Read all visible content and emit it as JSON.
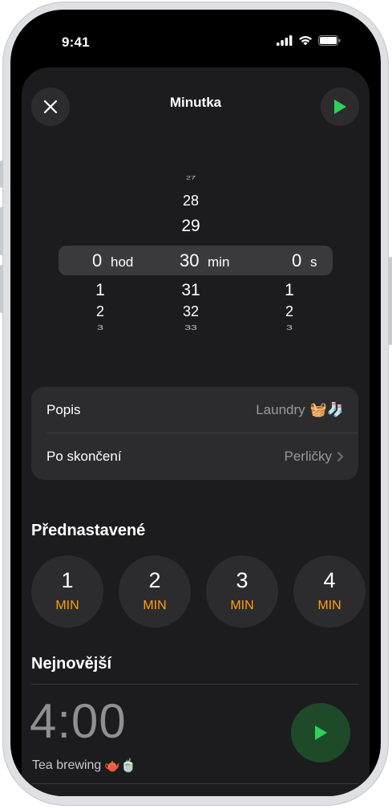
{
  "status_bar": {
    "time": "9:41"
  },
  "header": {
    "title": "Minutka"
  },
  "picker": {
    "hours": {
      "above": [],
      "selected": "0",
      "unit": "hod",
      "below": [
        "1",
        "2",
        "3"
      ]
    },
    "minutes": {
      "above": [
        "27",
        "28",
        "29"
      ],
      "selected": "30",
      "unit": "min",
      "below": [
        "31",
        "32",
        "33"
      ]
    },
    "seconds": {
      "above": [],
      "selected": "0",
      "unit": "s",
      "below": [
        "1",
        "2",
        "3"
      ]
    }
  },
  "settings": {
    "description_label": "Popis",
    "description_value": "Laundry",
    "description_emoji": "🧺🧦",
    "when_done_label": "Po skončení",
    "when_done_value": "Perličky"
  },
  "presets": {
    "title": "Přednastavené",
    "items": [
      {
        "value": "1",
        "unit": "MIN"
      },
      {
        "value": "2",
        "unit": "MIN"
      },
      {
        "value": "3",
        "unit": "MIN"
      },
      {
        "value": "4",
        "unit": "MIN"
      }
    ]
  },
  "recent": {
    "title": "Nejnovější",
    "time": "4:00",
    "label": "Tea brewing",
    "emoji": "🫖🍵"
  },
  "colors": {
    "accent_green": "#30d158",
    "accent_orange": "#ff9f0a",
    "sheet_bg": "#1c1c1e"
  }
}
